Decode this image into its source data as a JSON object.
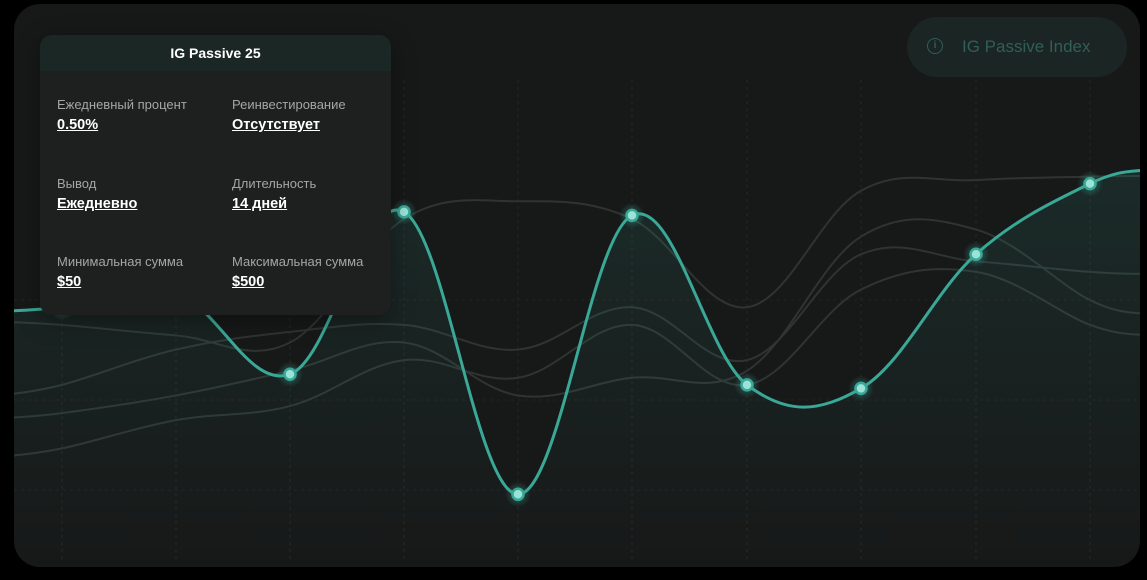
{
  "card": {
    "title": "IG Passive 25",
    "items": [
      {
        "label": "Ежедневный процент",
        "value": "0.50%"
      },
      {
        "label": "Реинвестирование",
        "value": "Отсутствует"
      },
      {
        "label": "Вывод",
        "value": "Ежедневно"
      },
      {
        "label": "Длительность",
        "value": "14 дней"
      },
      {
        "label": "Минимальная сумма",
        "value": "$50"
      },
      {
        "label": "Максимальная сумма",
        "value": "$500"
      }
    ]
  },
  "index_button": {
    "label": "IG Passive Index",
    "icon": "info-icon"
  },
  "colors": {
    "accent": "#3aa897",
    "point": "#9be3d6",
    "background": "#171818"
  },
  "chart_data": {
    "type": "line",
    "ylim": [
      0,
      100
    ],
    "grid": true,
    "series": [
      {
        "values": [
          60,
          64,
          41,
          87,
          7,
          86,
          38,
          37,
          75,
          95
        ]
      }
    ],
    "background_series": [
      {
        "values": [
          55,
          52,
          50,
          85,
          90,
          85,
          60,
          93,
          96,
          97
        ]
      },
      {
        "values": [
          38,
          48,
          53,
          55,
          48,
          60,
          45,
          75,
          73,
          70
        ]
      },
      {
        "values": [
          30,
          35,
          42,
          50,
          35,
          40,
          42,
          80,
          82,
          62
        ]
      },
      {
        "values": [
          20,
          28,
          32,
          45,
          40,
          55,
          38,
          65,
          70,
          55
        ]
      }
    ]
  }
}
